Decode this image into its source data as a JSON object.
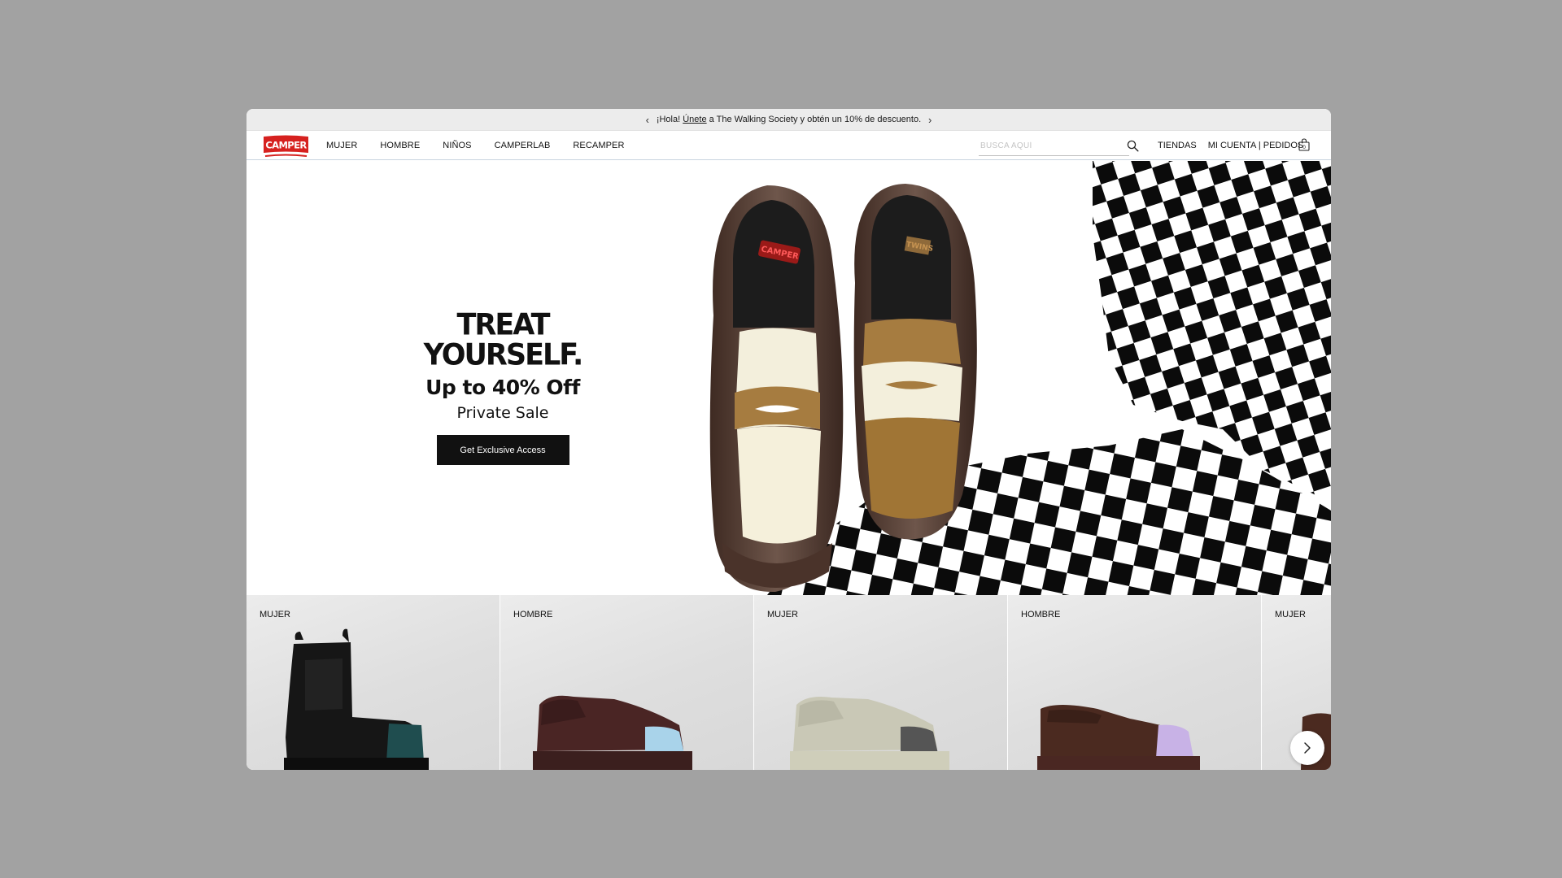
{
  "promo": {
    "prev": "‹",
    "text_before": "¡Hola! ",
    "link_text": "Únete",
    "text_after": " a The Walking Society y obtén un 10% de descuento.",
    "next": "›"
  },
  "header": {
    "logo_text": "CAMPER",
    "nav": [
      "MUJER",
      "HOMBRE",
      "NIÑOS",
      "CAMPERLAB",
      "RECAMPER"
    ],
    "search_placeholder": "BUSCA AQUÍ",
    "stores": "TIENDAS",
    "account": "MI CUENTA | PEDIDOS",
    "cart_count": "0"
  },
  "hero": {
    "title": "TREAT YOURSELF.",
    "subtitle": "Up to 40% Off",
    "tagline": "Private Sale",
    "cta": "Get Exclusive Access",
    "shoe_brand_left": "CAMPER",
    "shoe_brand_right": "TWINS"
  },
  "products": [
    {
      "label": "MUJER",
      "shoe": "chelsea-boot",
      "toe_color": "#1f4d4f"
    },
    {
      "label": "HOMBRE",
      "shoe": "sneaker",
      "toe_color": "#a9d3ea"
    },
    {
      "label": "MUJER",
      "shoe": "sneaker",
      "toe_color": "#555555"
    },
    {
      "label": "HOMBRE",
      "shoe": "loafer",
      "toe_color": "#c8b2e6"
    },
    {
      "label": "MUJER",
      "shoe": "loafer",
      "toe_color": "#c8b2e6"
    }
  ],
  "colors": {
    "brand_red": "#d6211f",
    "cta_bg": "#111111",
    "page_bg": "#a2a2a2"
  },
  "icons": {
    "search": "search-icon",
    "cart": "bag-icon",
    "next": "chevron-right-icon"
  }
}
